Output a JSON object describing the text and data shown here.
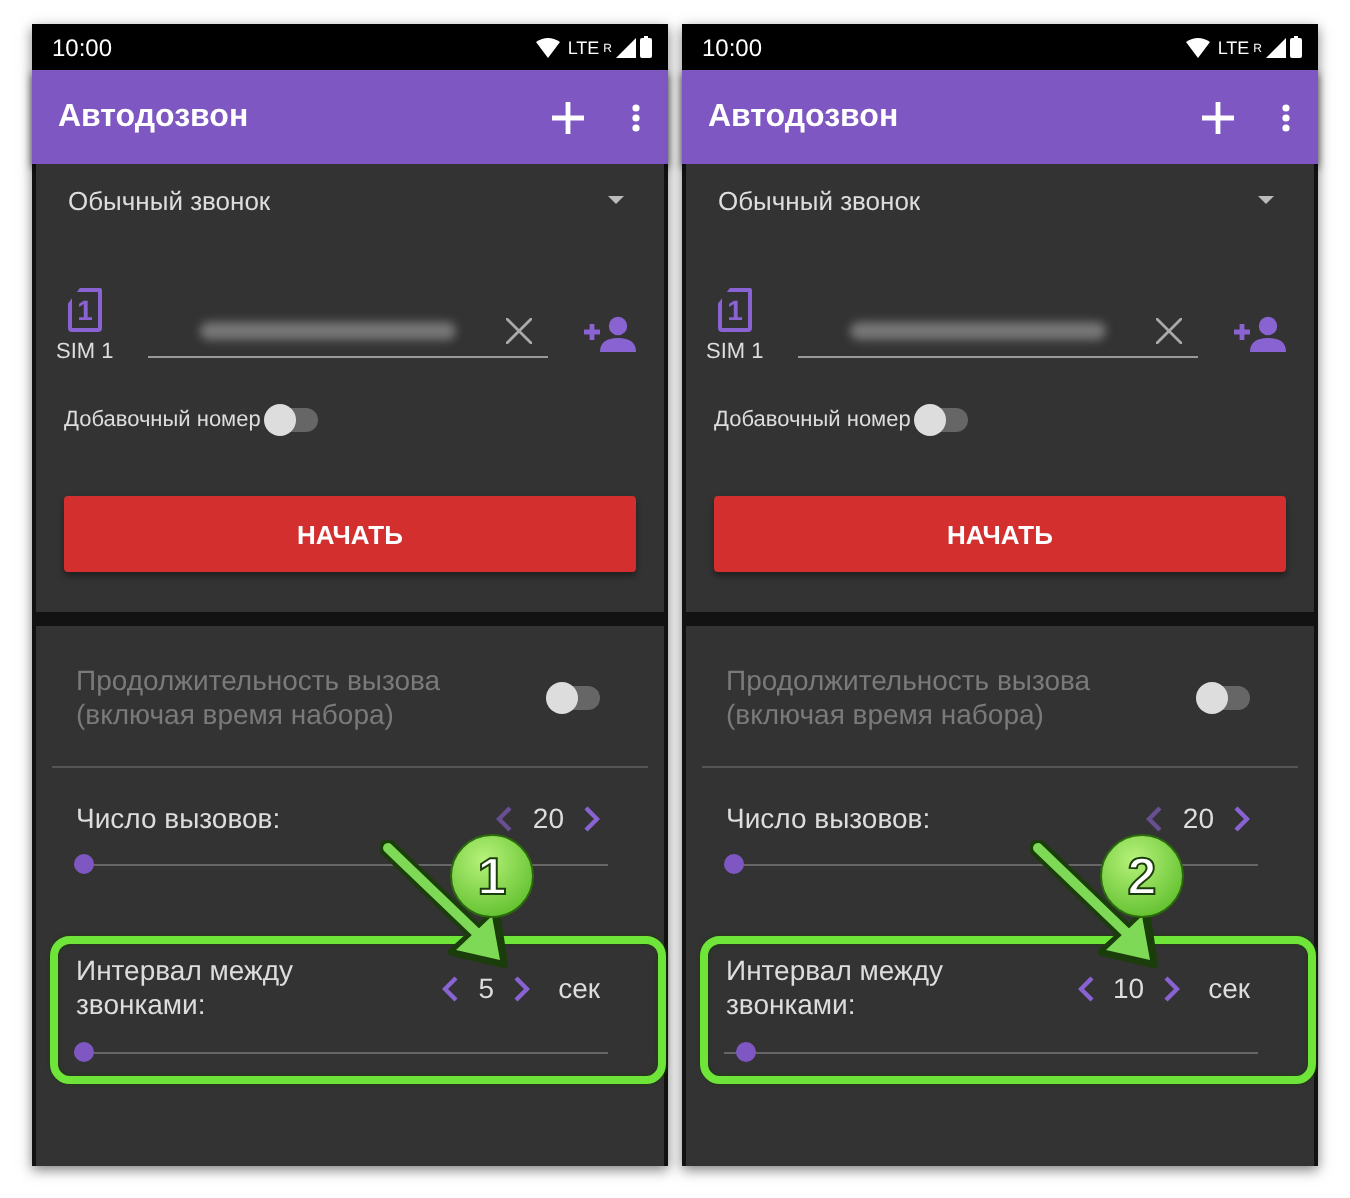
{
  "panels": [
    {
      "status_bar": {
        "time": "10:00",
        "network": "LTE",
        "roaming": "R"
      },
      "app_bar": {
        "title": "Автодозвон"
      },
      "call_type": "Обычный звонок",
      "sim_label": "SIM 1",
      "sim_number": "1",
      "extension": {
        "label": "Добавочный номер",
        "on": false
      },
      "start_button": "НАЧАТЬ",
      "duration": {
        "label": "Продолжительность вызова (включая время набора)",
        "on": false,
        "disabled": true
      },
      "calls": {
        "label": "Число вызовов:",
        "value": "20",
        "level": 0
      },
      "interval": {
        "label": "Интервал между звонками:",
        "value": "5",
        "unit": "сек",
        "level": 0
      },
      "callout": {
        "number": "1"
      }
    },
    {
      "status_bar": {
        "time": "10:00",
        "network": "LTE",
        "roaming": "R"
      },
      "app_bar": {
        "title": "Автодозвон"
      },
      "call_type": "Обычный звонок",
      "sim_label": "SIM 1",
      "sim_number": "1",
      "extension": {
        "label": "Добавочный номер",
        "on": false
      },
      "start_button": "НАЧАТЬ",
      "duration": {
        "label": "Продолжительность вызова (включая время набора)",
        "on": false,
        "disabled": true
      },
      "calls": {
        "label": "Число вызовов:",
        "value": "20",
        "level": 0
      },
      "interval": {
        "label": "Интервал между звонками:",
        "value": "10",
        "unit": "сек",
        "level": 0.025
      },
      "callout": {
        "number": "2"
      }
    }
  ]
}
